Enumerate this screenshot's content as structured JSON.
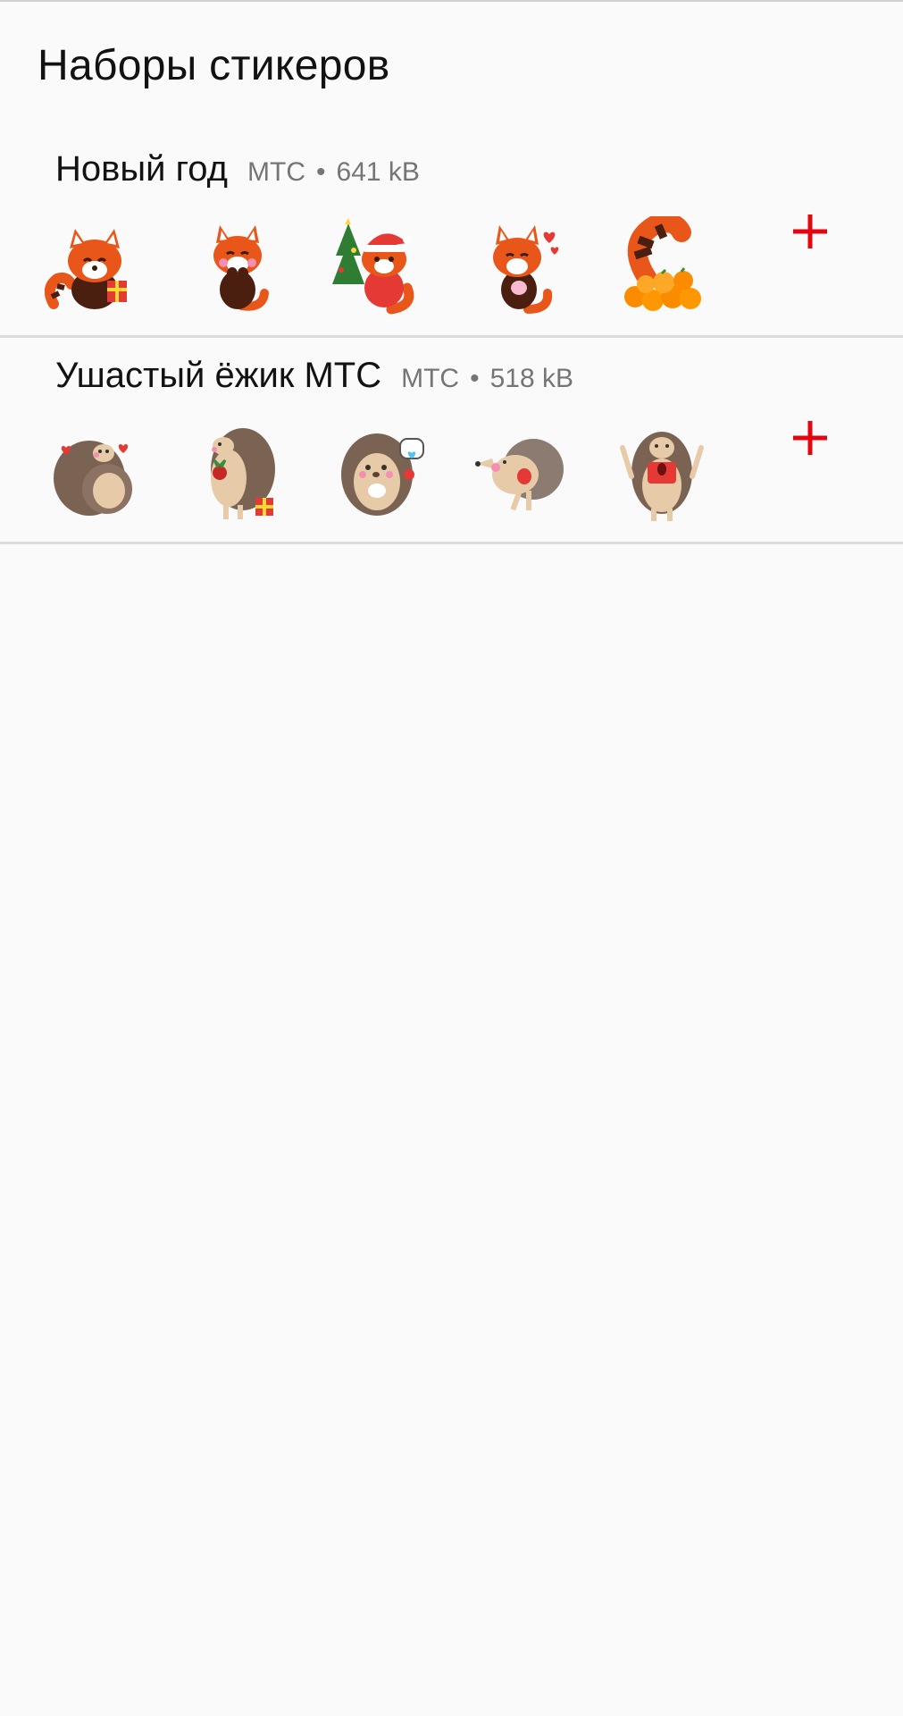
{
  "page": {
    "title": "Наборы стикеров"
  },
  "packs": [
    {
      "name": "Новый год",
      "author": "МТС",
      "separator": "•",
      "size": "641 kB",
      "stickers": [
        {
          "icon": "red-panda-with-gift-icon"
        },
        {
          "icon": "red-panda-shy-icon"
        },
        {
          "icon": "red-panda-santa-hat-tree-icon"
        },
        {
          "icon": "red-panda-hearts-icon"
        },
        {
          "icon": "red-panda-tangerines-icon"
        }
      ],
      "add_icon": "plus-icon"
    },
    {
      "name": "Ушастый ёжик МТС",
      "author": "МТС",
      "separator": "•",
      "size": "518 kB",
      "stickers": [
        {
          "icon": "hedgehog-hug-icon"
        },
        {
          "icon": "hedgehog-gift-icon"
        },
        {
          "icon": "hedgehog-message-icon"
        },
        {
          "icon": "hedgehog-running-icon"
        },
        {
          "icon": "hedgehog-surprised-icon"
        }
      ],
      "add_icon": "plus-icon"
    }
  ],
  "colors": {
    "background": "#fafafa",
    "divider": "#dcdcdc",
    "accent": "#e30611",
    "meta_text": "#757575",
    "panda_orange": "#e8561a",
    "panda_dark": "#4a1f10",
    "hedgehog_brown": "#7a6353",
    "hedgehog_face": "#e7cba8"
  }
}
